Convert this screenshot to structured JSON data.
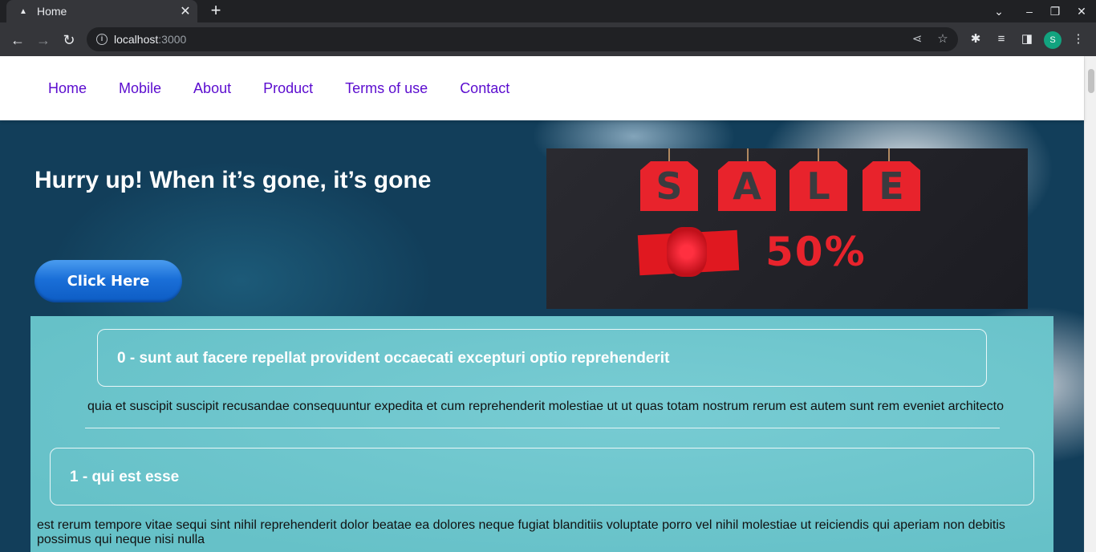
{
  "browser": {
    "tab_title": "Home",
    "url_host": "localhost",
    "url_port": ":3000",
    "profile_initial": "S"
  },
  "nav": {
    "items": [
      "Home",
      "Mobile",
      "About",
      "Product",
      "Terms of use",
      "Contact"
    ]
  },
  "hero": {
    "title": "Hurry up! When it’s gone, it’s gone",
    "button_label": "Click Here",
    "sale_letters": [
      "S",
      "A",
      "L",
      "E"
    ],
    "sale_percent": "50%"
  },
  "posts": [
    {
      "title": "0 - sunt aut facere repellat provident occaecati excepturi optio reprehenderit",
      "body": "quia et suscipit suscipit recusandae consequuntur expedita et cum reprehenderit molestiae ut ut quas totam nostrum rerum est autem sunt rem eveniet architecto"
    },
    {
      "title": "1 - qui est esse",
      "body": "est rerum tempore vitae sequi sint nihil reprehenderit dolor beatae ea dolores neque fugiat blanditiis voluptate porro vel nihil molestiae ut reiciendis qui aperiam non debitis possimus qui neque nisi nulla"
    }
  ],
  "colors": {
    "nav_link": "#5b0ccf",
    "button": "#1a6fd8",
    "content_bg": "#6ec5cc"
  }
}
